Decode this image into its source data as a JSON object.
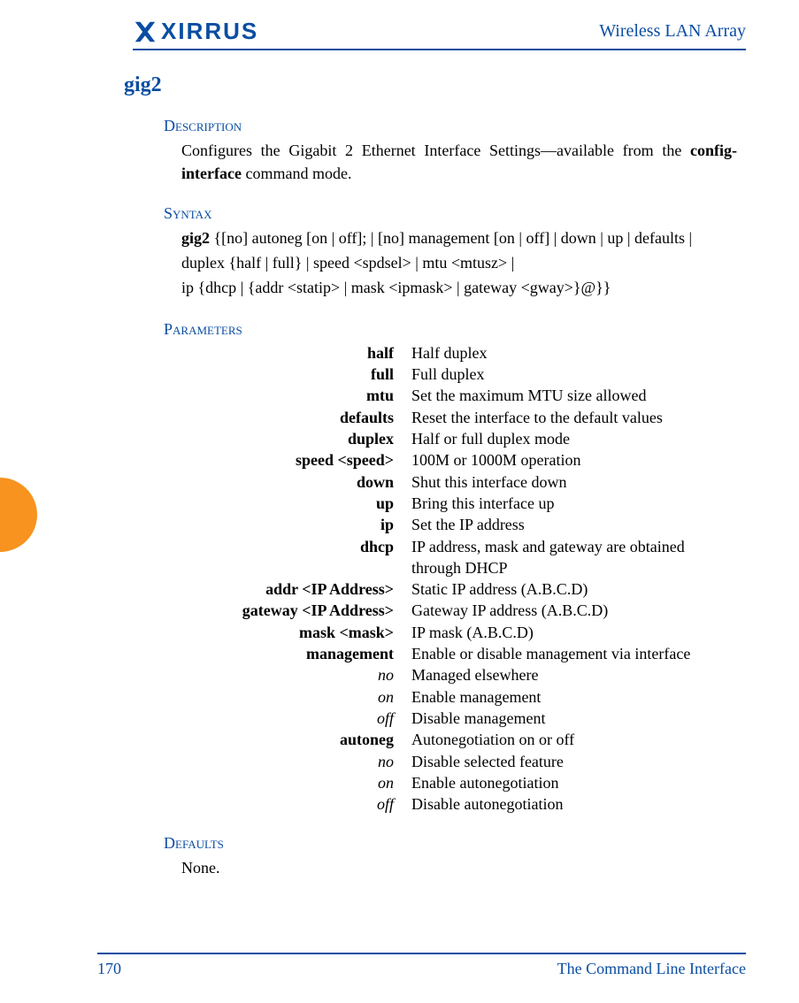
{
  "header": {
    "logo_text": "XIRRUS",
    "product_name": "Wireless LAN Array"
  },
  "command": {
    "name": "gig2"
  },
  "description": {
    "label": "Description",
    "body_pre": "Configures the Gigabit 2 Ethernet Interface Settings—available from the ",
    "body_bold": "config-interface",
    "body_post": " command mode."
  },
  "syntax": {
    "label": "Syntax",
    "cmd_bold": "gig2 ",
    "line1": "{[no] autoneg [on | off]; | [no] management [on | off] | down | up | defaults | duplex {half | full} | speed <spdsel> | mtu <mtusz> |",
    "line2": "ip {dhcp | {addr <statip> | mask <ipmask> | gateway <gway>}@}}"
  },
  "parameters": {
    "label": "Parameters",
    "rows": [
      {
        "name": "half",
        "desc": "Half duplex",
        "italic": false
      },
      {
        "name": "full",
        "desc": "Full duplex",
        "italic": false
      },
      {
        "name": "mtu",
        "desc": "Set the maximum MTU size allowed",
        "italic": false
      },
      {
        "name": "defaults",
        "desc": "Reset the interface to the default values",
        "italic": false
      },
      {
        "name": "duplex",
        "desc": "Half or full duplex mode",
        "italic": false
      },
      {
        "name": "speed <speed>",
        "desc": "100M or 1000M operation",
        "italic": false
      },
      {
        "name": "down",
        "desc": "Shut this interface down",
        "italic": false
      },
      {
        "name": "up",
        "desc": "Bring this interface up",
        "italic": false
      },
      {
        "name": "ip",
        "desc": "Set the IP address",
        "italic": false
      },
      {
        "name": "dhcp",
        "desc": "IP address, mask and gateway are obtained through DHCP",
        "italic": false
      },
      {
        "name": "addr <IP Address>",
        "desc": "Static IP address (A.B.C.D)",
        "italic": false
      },
      {
        "name": "gateway <IP Address>",
        "desc": "Gateway IP address (A.B.C.D)",
        "italic": false
      },
      {
        "name": "mask <mask>",
        "desc": "IP mask (A.B.C.D)",
        "italic": false
      },
      {
        "name": "management",
        "desc": "Enable or disable management via interface",
        "italic": false
      },
      {
        "name": "no",
        "desc": "Managed elsewhere",
        "italic": true
      },
      {
        "name": "on",
        "desc": "Enable management",
        "italic": true
      },
      {
        "name": "off",
        "desc": "Disable management",
        "italic": true
      },
      {
        "name": "autoneg",
        "desc": "Autonegotiation on or off",
        "italic": false
      },
      {
        "name": "no",
        "desc": "Disable selected feature",
        "italic": true
      },
      {
        "name": "on",
        "desc": "Enable autonegotiation",
        "italic": true
      },
      {
        "name": "off",
        "desc": "Disable autonegotiation",
        "italic": true
      }
    ]
  },
  "defaults": {
    "label": "Defaults",
    "body": "None."
  },
  "footer": {
    "page_number": "170",
    "section": "The Command Line Interface"
  }
}
